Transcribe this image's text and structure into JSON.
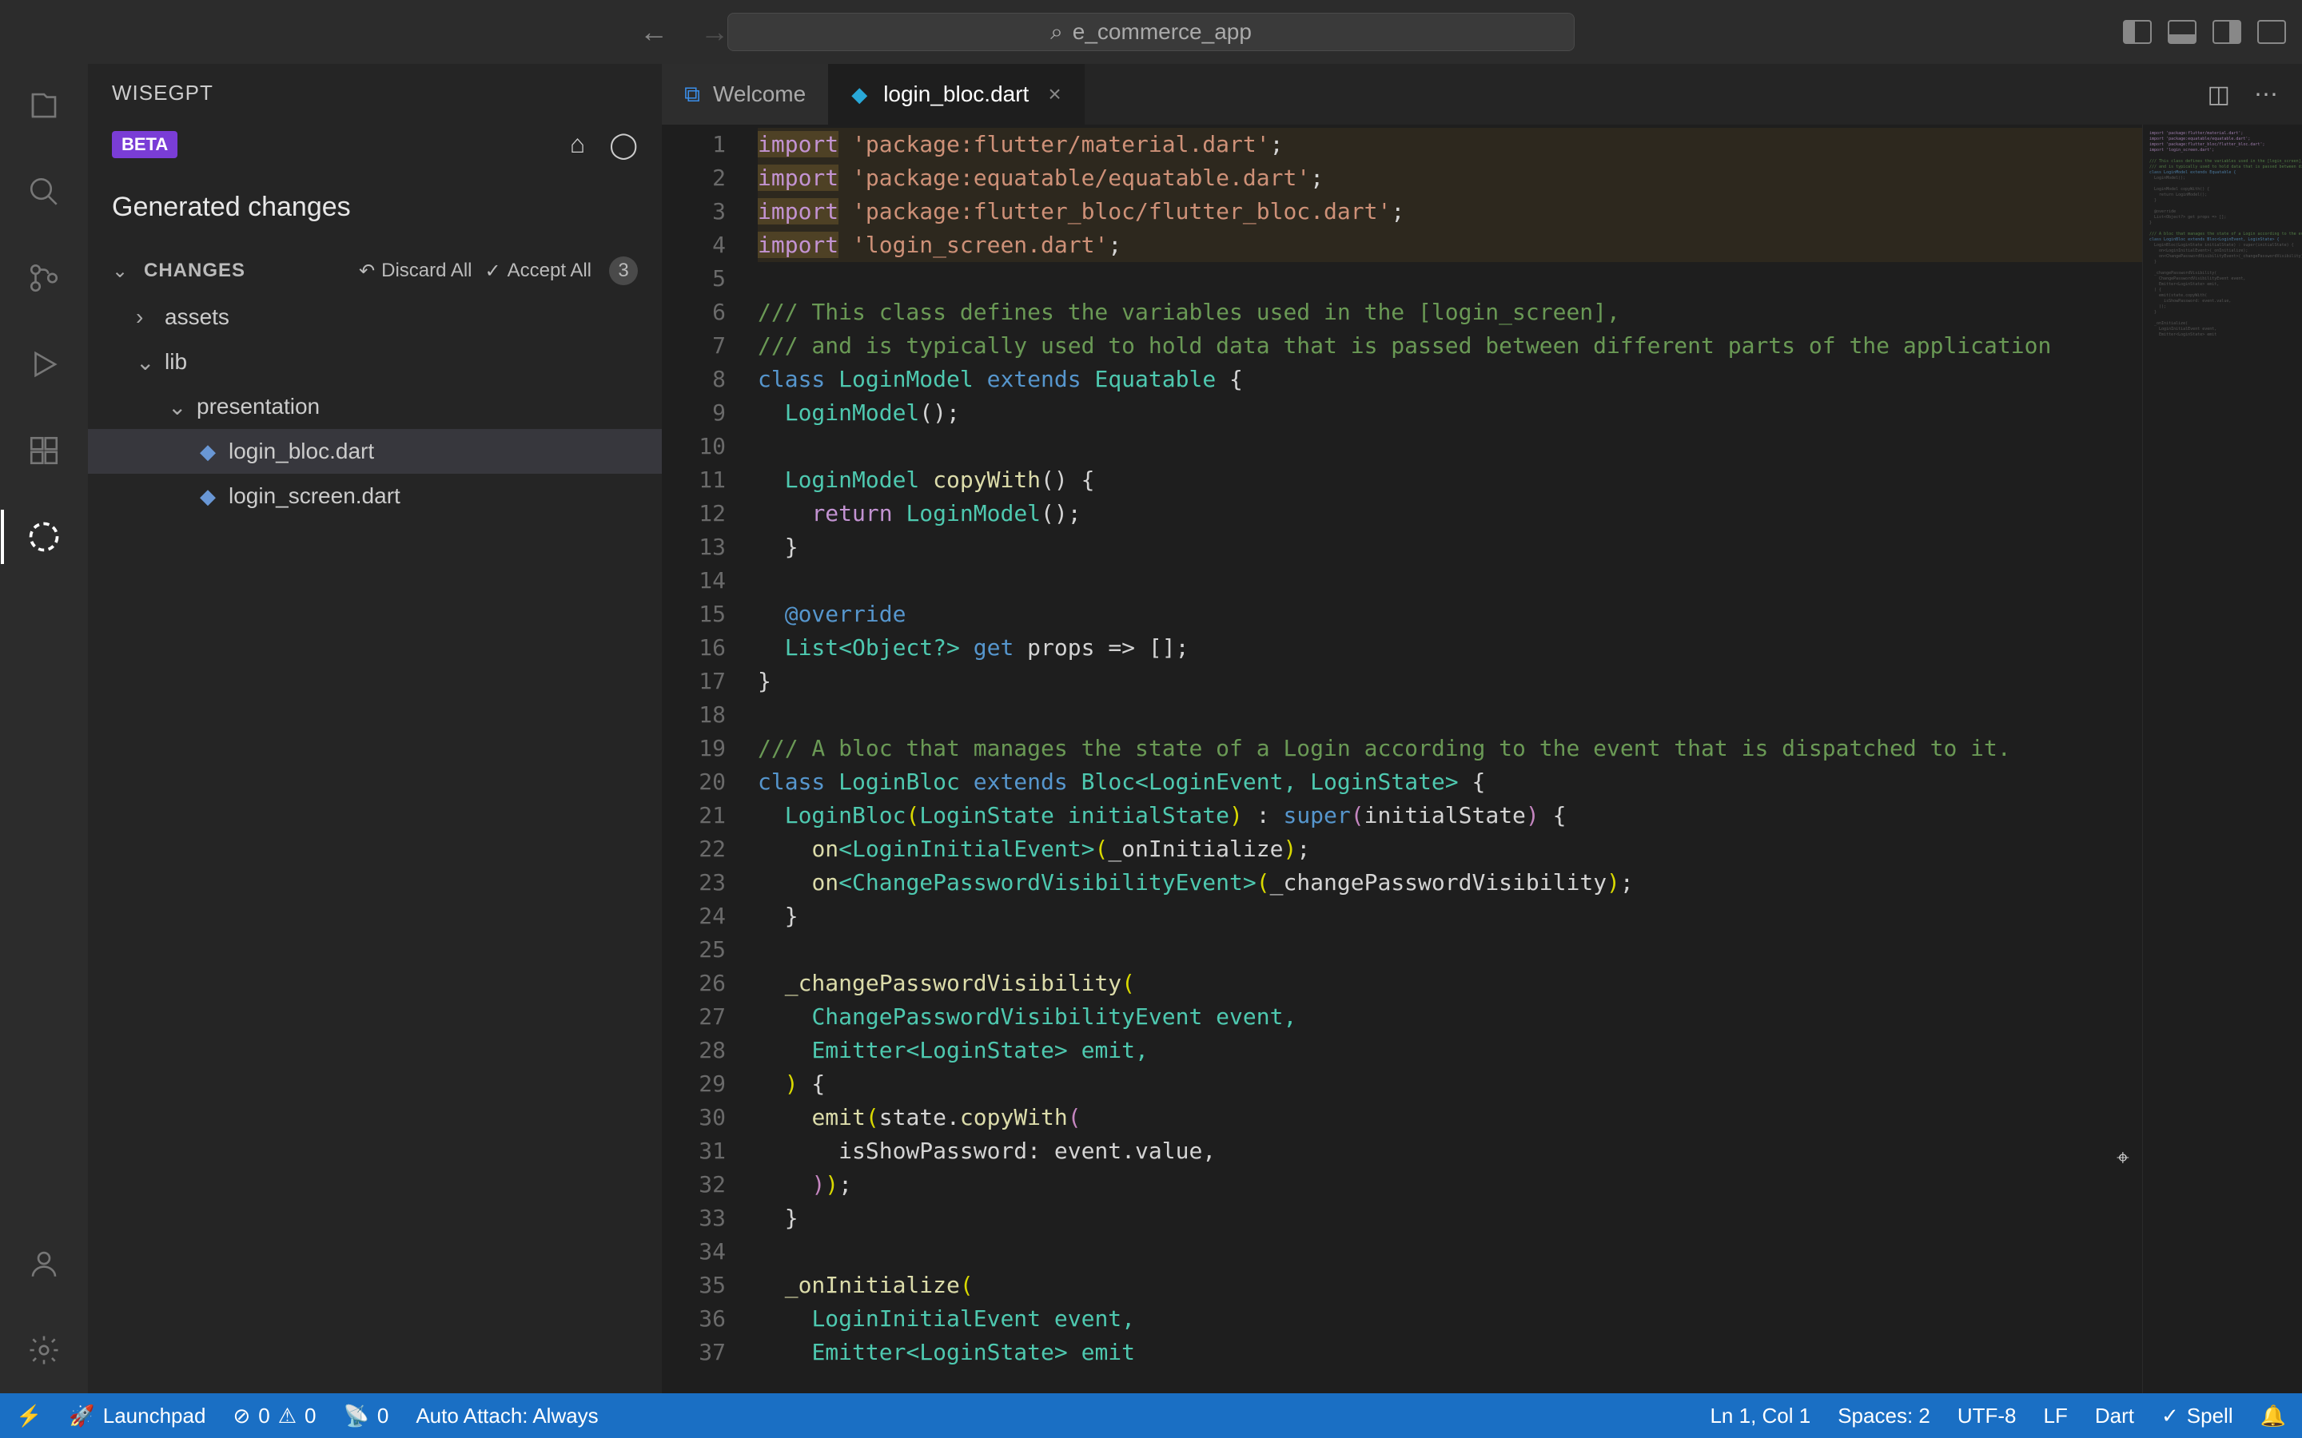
{
  "titlebar": {
    "search_text": "e_commerce_app"
  },
  "sidebar": {
    "extension_name": "WISEGPT",
    "beta_label": "BETA",
    "section_title": "Generated changes",
    "changes_label": "CHANGES",
    "discard_label": "Discard All",
    "accept_label": "Accept All",
    "change_count": "3",
    "tree": {
      "folder1": "assets",
      "folder2": "lib",
      "folder3": "presentation",
      "file1": "login_bloc.dart",
      "file2": "login_screen.dart"
    }
  },
  "tabs": {
    "welcome": "Welcome",
    "active_file": "login_bloc.dart"
  },
  "code_lines": [
    {
      "n": 1,
      "hl": true,
      "parts": [
        [
          "import",
          "tok-import"
        ],
        [
          " ",
          "tok-plain"
        ],
        [
          "'package:flutter/material.dart'",
          "tok-str"
        ],
        [
          ";",
          "tok-punc"
        ]
      ]
    },
    {
      "n": 2,
      "hl": true,
      "parts": [
        [
          "import",
          "tok-import"
        ],
        [
          " ",
          "tok-plain"
        ],
        [
          "'package:equatable/equatable.dart'",
          "tok-str"
        ],
        [
          ";",
          "tok-punc"
        ]
      ]
    },
    {
      "n": 3,
      "hl": true,
      "parts": [
        [
          "import",
          "tok-import"
        ],
        [
          " ",
          "tok-plain"
        ],
        [
          "'package:flutter_bloc/flutter_bloc.dart'",
          "tok-str"
        ],
        [
          ";",
          "tok-punc"
        ]
      ]
    },
    {
      "n": 4,
      "hl": true,
      "parts": [
        [
          "import",
          "tok-import"
        ],
        [
          " ",
          "tok-plain"
        ],
        [
          "'login_screen.dart'",
          "tok-str"
        ],
        [
          ";",
          "tok-punc"
        ]
      ]
    },
    {
      "n": 5,
      "hl": false,
      "parts": []
    },
    {
      "n": 6,
      "hl": false,
      "parts": [
        [
          "/// This class defines the variables used in the [login_screen],",
          "tok-comment"
        ]
      ]
    },
    {
      "n": 7,
      "hl": false,
      "parts": [
        [
          "/// and is typically used to hold data that is passed between different parts of the application",
          "tok-comment"
        ]
      ]
    },
    {
      "n": 8,
      "hl": false,
      "parts": [
        [
          "class",
          "tok-class"
        ],
        [
          " ",
          "tok-plain"
        ],
        [
          "LoginModel ",
          "tok-type"
        ],
        [
          "extends",
          "tok-class"
        ],
        [
          " ",
          "tok-plain"
        ],
        [
          "Equatable ",
          "tok-type"
        ],
        [
          "{",
          "tok-punc"
        ]
      ]
    },
    {
      "n": 9,
      "hl": false,
      "parts": [
        [
          "  ",
          "tok-plain"
        ],
        [
          "LoginModel",
          "tok-type"
        ],
        [
          "();",
          "tok-punc"
        ]
      ]
    },
    {
      "n": 10,
      "hl": false,
      "parts": []
    },
    {
      "n": 11,
      "hl": false,
      "parts": [
        [
          "  ",
          "tok-plain"
        ],
        [
          "LoginModel ",
          "tok-type"
        ],
        [
          "copyWith",
          "tok-call"
        ],
        [
          "() {",
          "tok-punc"
        ]
      ]
    },
    {
      "n": 12,
      "hl": false,
      "parts": [
        [
          "    ",
          "tok-plain"
        ],
        [
          "return",
          "tok-return"
        ],
        [
          " ",
          "tok-plain"
        ],
        [
          "LoginModel",
          "tok-type"
        ],
        [
          "();",
          "tok-punc"
        ]
      ]
    },
    {
      "n": 13,
      "hl": false,
      "parts": [
        [
          "  }",
          "tok-punc"
        ]
      ]
    },
    {
      "n": 14,
      "hl": false,
      "parts": []
    },
    {
      "n": 15,
      "hl": false,
      "parts": [
        [
          "  ",
          "tok-plain"
        ],
        [
          "@override",
          "tok-anno"
        ]
      ]
    },
    {
      "n": 16,
      "hl": false,
      "parts": [
        [
          "  ",
          "tok-plain"
        ],
        [
          "List<Object?> ",
          "tok-type"
        ],
        [
          "get",
          "tok-class"
        ],
        [
          " props => [];",
          "tok-plain"
        ]
      ]
    },
    {
      "n": 17,
      "hl": false,
      "parts": [
        [
          "}",
          "tok-punc"
        ]
      ]
    },
    {
      "n": 18,
      "hl": false,
      "parts": []
    },
    {
      "n": 19,
      "hl": false,
      "parts": [
        [
          "/// A bloc that manages the state of a Login according to the event that is dispatched to it.",
          "tok-comment"
        ]
      ]
    },
    {
      "n": 20,
      "hl": false,
      "parts": [
        [
          "class",
          "tok-class"
        ],
        [
          " ",
          "tok-plain"
        ],
        [
          "LoginBloc ",
          "tok-type"
        ],
        [
          "extends",
          "tok-class"
        ],
        [
          " ",
          "tok-plain"
        ],
        [
          "Bloc<LoginEvent, LoginState> ",
          "tok-type"
        ],
        [
          "{",
          "tok-punc"
        ]
      ]
    },
    {
      "n": 21,
      "hl": false,
      "parts": [
        [
          "  ",
          "tok-plain"
        ],
        [
          "LoginBloc",
          "tok-type"
        ],
        [
          "(",
          "tok-paren-y"
        ],
        [
          "LoginState initialState",
          "tok-type"
        ],
        [
          ")",
          "tok-paren-y"
        ],
        [
          " : ",
          "tok-plain"
        ],
        [
          "super",
          "tok-super"
        ],
        [
          "(",
          "tok-paren-p"
        ],
        [
          "initialState",
          "tok-plain"
        ],
        [
          ")",
          "tok-paren-p"
        ],
        [
          " {",
          "tok-punc"
        ]
      ]
    },
    {
      "n": 22,
      "hl": false,
      "parts": [
        [
          "    ",
          "tok-plain"
        ],
        [
          "on",
          "tok-call"
        ],
        [
          "<LoginInitialEvent>",
          "tok-type"
        ],
        [
          "(",
          "tok-paren-y"
        ],
        [
          "_onInitialize",
          "tok-plain"
        ],
        [
          ")",
          "tok-paren-y"
        ],
        [
          ";",
          "tok-punc"
        ]
      ]
    },
    {
      "n": 23,
      "hl": false,
      "parts": [
        [
          "    ",
          "tok-plain"
        ],
        [
          "on",
          "tok-call"
        ],
        [
          "<ChangePasswordVisibilityEvent>",
          "tok-type"
        ],
        [
          "(",
          "tok-paren-y"
        ],
        [
          "_changePasswordVisibility",
          "tok-plain"
        ],
        [
          ")",
          "tok-paren-y"
        ],
        [
          ";",
          "tok-punc"
        ]
      ]
    },
    {
      "n": 24,
      "hl": false,
      "parts": [
        [
          "  }",
          "tok-punc"
        ]
      ]
    },
    {
      "n": 25,
      "hl": false,
      "parts": []
    },
    {
      "n": 26,
      "hl": false,
      "parts": [
        [
          "  ",
          "tok-plain"
        ],
        [
          "_changePasswordVisibility",
          "tok-call"
        ],
        [
          "(",
          "tok-paren-y"
        ]
      ]
    },
    {
      "n": 27,
      "hl": false,
      "parts": [
        [
          "    ",
          "tok-plain"
        ],
        [
          "ChangePasswordVisibilityEvent event,",
          "tok-type"
        ]
      ]
    },
    {
      "n": 28,
      "hl": false,
      "parts": [
        [
          "    ",
          "tok-plain"
        ],
        [
          "Emitter<LoginState> emit,",
          "tok-type"
        ]
      ]
    },
    {
      "n": 29,
      "hl": false,
      "parts": [
        [
          "  ",
          "tok-plain"
        ],
        [
          ")",
          "tok-paren-y"
        ],
        [
          " {",
          "tok-punc"
        ]
      ]
    },
    {
      "n": 30,
      "hl": false,
      "parts": [
        [
          "    ",
          "tok-plain"
        ],
        [
          "emit",
          "tok-call"
        ],
        [
          "(",
          "tok-paren-y"
        ],
        [
          "state.",
          "tok-plain"
        ],
        [
          "copyWith",
          "tok-call"
        ],
        [
          "(",
          "tok-paren-p"
        ]
      ]
    },
    {
      "n": 31,
      "hl": false,
      "parts": [
        [
          "      isShowPassword: event.value,",
          "tok-plain"
        ]
      ]
    },
    {
      "n": 32,
      "hl": false,
      "parts": [
        [
          "    ",
          "tok-plain"
        ],
        [
          ")",
          "tok-paren-p"
        ],
        [
          ")",
          "tok-paren-y"
        ],
        [
          ";",
          "tok-punc"
        ]
      ]
    },
    {
      "n": 33,
      "hl": false,
      "parts": [
        [
          "  }",
          "tok-punc"
        ]
      ]
    },
    {
      "n": 34,
      "hl": false,
      "parts": []
    },
    {
      "n": 35,
      "hl": false,
      "parts": [
        [
          "  ",
          "tok-plain"
        ],
        [
          "_onInitialize",
          "tok-call"
        ],
        [
          "(",
          "tok-paren-y"
        ]
      ]
    },
    {
      "n": 36,
      "hl": false,
      "parts": [
        [
          "    ",
          "tok-plain"
        ],
        [
          "LoginInitialEvent event,",
          "tok-type"
        ]
      ]
    },
    {
      "n": 37,
      "hl": false,
      "parts": [
        [
          "    ",
          "tok-plain"
        ],
        [
          "Emitter<LoginState> emit",
          "tok-type"
        ]
      ]
    }
  ],
  "statusbar": {
    "launchpad": "Launchpad",
    "errors": "0",
    "warnings": "0",
    "ports": "0",
    "auto_attach": "Auto Attach: Always",
    "position": "Ln 1, Col 1",
    "spaces": "Spaces: 2",
    "encoding": "UTF-8",
    "eol": "LF",
    "language": "Dart",
    "spell": "Spell"
  }
}
